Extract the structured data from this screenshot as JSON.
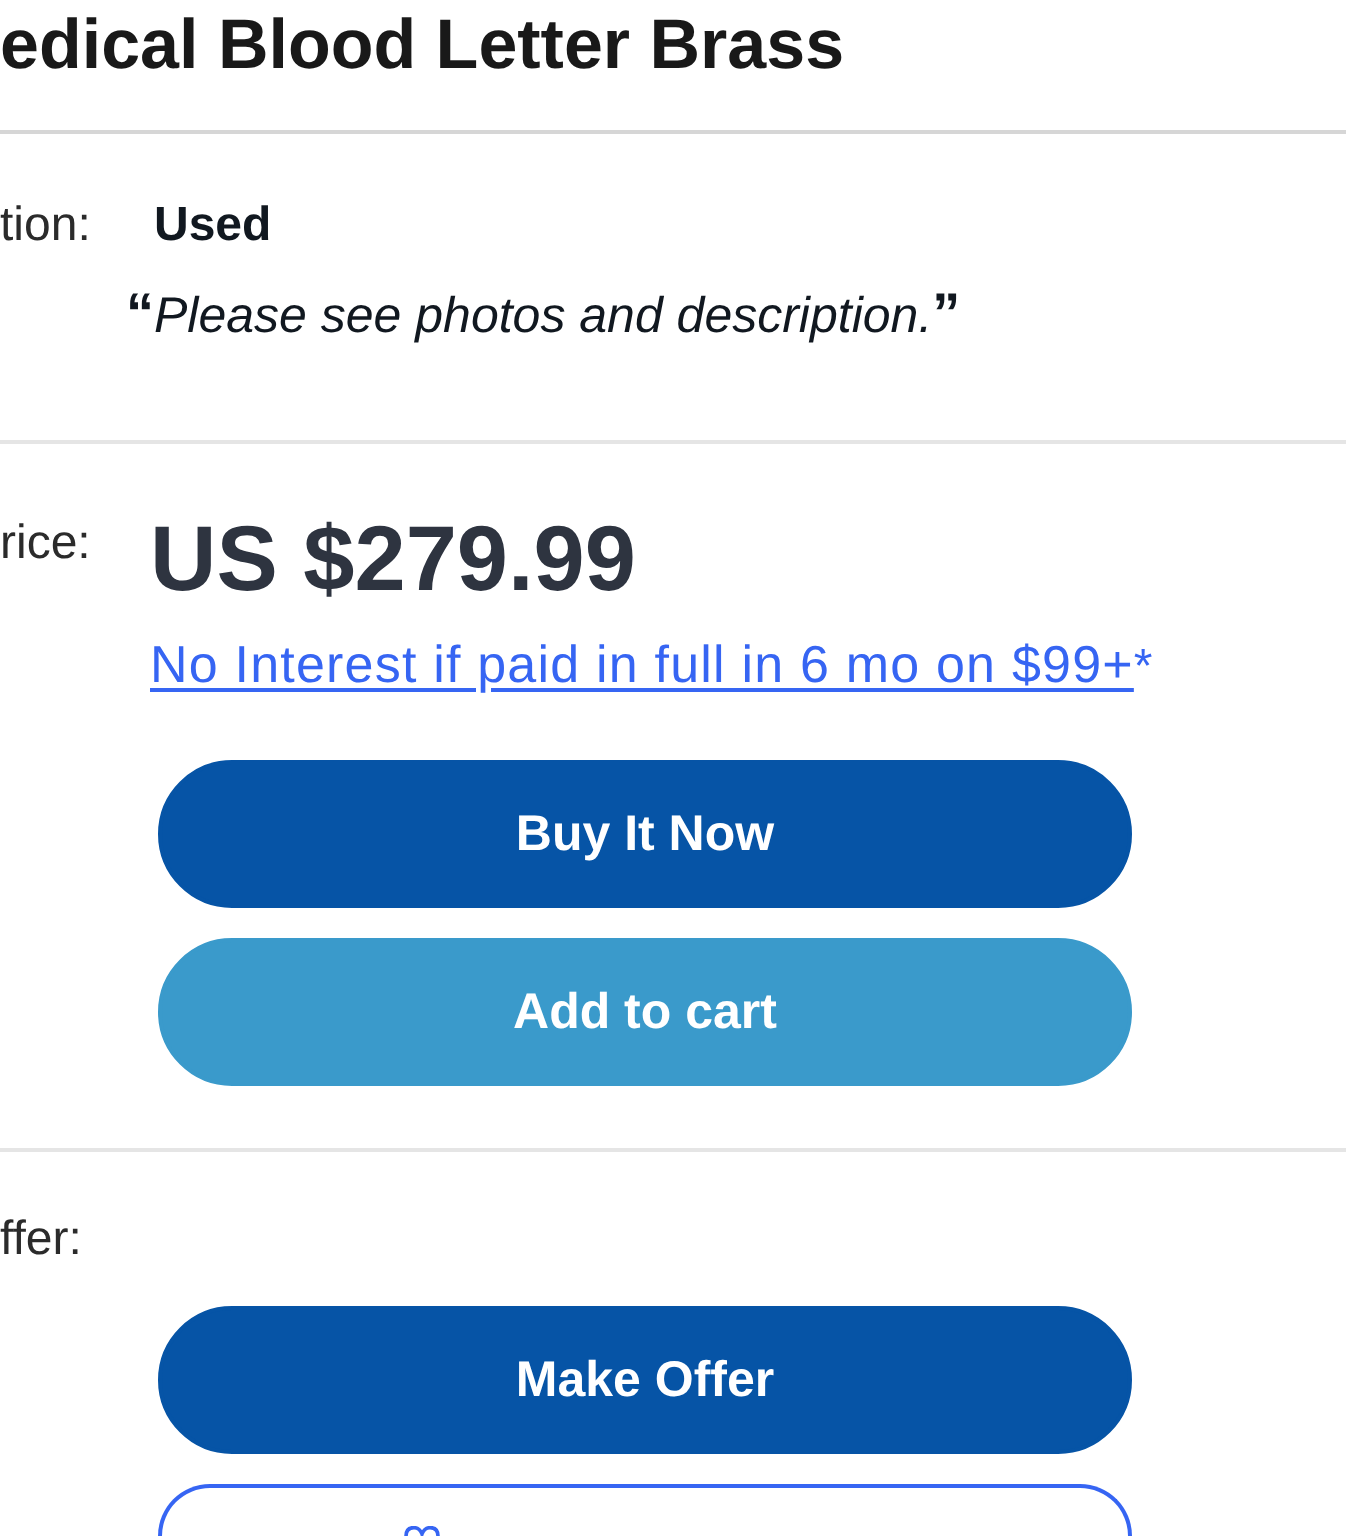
{
  "title": "edical Blood Letter Brass",
  "condition": {
    "label": "tion:",
    "value": "Used",
    "note": "**“**​*Please see photos and description.*​**”**"
  },
  "price": {
    "label": "rice:",
    "amount": "US $279.99",
    "financing_link": "No Interest if paid in full in 6 mo on $99+",
    "footnote_mark": "*",
    "buttons": [
      {
        "label": "Buy It Now",
        "kind": "primary"
      },
      {
        "label": "Add to cart",
        "kind": "secondary"
      }
    ]
  },
  "offer": {
    "label": "ffer:",
    "buttons": [
      {
        "label": "Make Offer",
        "kind": "primary"
      },
      {
        "kind": "outline"
      }
    ]
  }
}
